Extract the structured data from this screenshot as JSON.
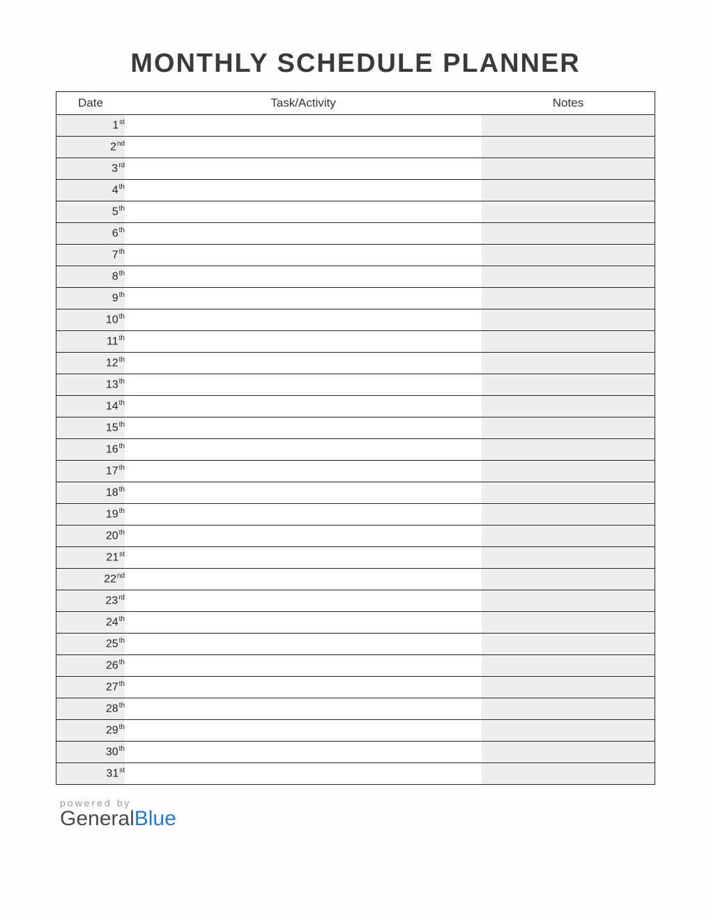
{
  "title": "MONTHLY SCHEDULE PLANNER",
  "columns": {
    "date": "Date",
    "task": "Task/Activity",
    "notes": "Notes"
  },
  "rows": [
    {
      "day": "1",
      "suffix": "st",
      "task": "",
      "notes": ""
    },
    {
      "day": "2",
      "suffix": "nd",
      "task": "",
      "notes": ""
    },
    {
      "day": "3",
      "suffix": "rd",
      "task": "",
      "notes": ""
    },
    {
      "day": "4",
      "suffix": "th",
      "task": "",
      "notes": ""
    },
    {
      "day": "5",
      "suffix": "th",
      "task": "",
      "notes": ""
    },
    {
      "day": "6",
      "suffix": "th",
      "task": "",
      "notes": ""
    },
    {
      "day": "7",
      "suffix": "th",
      "task": "",
      "notes": ""
    },
    {
      "day": "8",
      "suffix": "th",
      "task": "",
      "notes": ""
    },
    {
      "day": "9",
      "suffix": "th",
      "task": "",
      "notes": ""
    },
    {
      "day": "10",
      "suffix": "th",
      "task": "",
      "notes": ""
    },
    {
      "day": "11",
      "suffix": "th",
      "task": "",
      "notes": ""
    },
    {
      "day": "12",
      "suffix": "th",
      "task": "",
      "notes": ""
    },
    {
      "day": "13",
      "suffix": "th",
      "task": "",
      "notes": ""
    },
    {
      "day": "14",
      "suffix": "th",
      "task": "",
      "notes": ""
    },
    {
      "day": "15",
      "suffix": "th",
      "task": "",
      "notes": ""
    },
    {
      "day": "16",
      "suffix": "th",
      "task": "",
      "notes": ""
    },
    {
      "day": "17",
      "suffix": "th",
      "task": "",
      "notes": ""
    },
    {
      "day": "18",
      "suffix": "th",
      "task": "",
      "notes": ""
    },
    {
      "day": "19",
      "suffix": "th",
      "task": "",
      "notes": ""
    },
    {
      "day": "20",
      "suffix": "th",
      "task": "",
      "notes": ""
    },
    {
      "day": "21",
      "suffix": "st",
      "task": "",
      "notes": ""
    },
    {
      "day": "22",
      "suffix": "nd",
      "task": "",
      "notes": ""
    },
    {
      "day": "23",
      "suffix": "rd",
      "task": "",
      "notes": ""
    },
    {
      "day": "24",
      "suffix": "th",
      "task": "",
      "notes": ""
    },
    {
      "day": "25",
      "suffix": "th",
      "task": "",
      "notes": ""
    },
    {
      "day": "26",
      "suffix": "th",
      "task": "",
      "notes": ""
    },
    {
      "day": "27",
      "suffix": "th",
      "task": "",
      "notes": ""
    },
    {
      "day": "28",
      "suffix": "th",
      "task": "",
      "notes": ""
    },
    {
      "day": "29",
      "suffix": "th",
      "task": "",
      "notes": ""
    },
    {
      "day": "30",
      "suffix": "th",
      "task": "",
      "notes": ""
    },
    {
      "day": "31",
      "suffix": "st",
      "task": "",
      "notes": ""
    }
  ],
  "footer": {
    "powered_by": "powered by",
    "brand_part1": "General",
    "brand_part2": "Blue"
  }
}
